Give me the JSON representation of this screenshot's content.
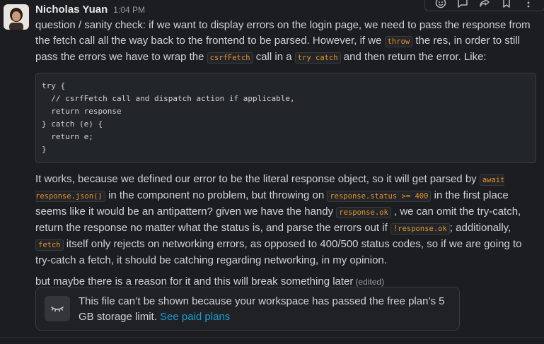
{
  "message": {
    "author": "Nicholas Yuan",
    "time": "1:04 PM",
    "para1": {
      "t1": "question / sanity check: if we want to display errors on the login page, we need to pass the response from the fetch call all the way back to the frontend to be parsed. However, if we ",
      "c1": "throw",
      "t2": " the res, in order to still pass the errors we have to wrap the ",
      "c2": "csrfFetch",
      "t3": " call in a ",
      "c3": "try catch",
      "t4": " and then return the error. Like:"
    },
    "code_block": "try {\n  // csrfFetch call and dispatch action if applicable,\n  return response\n} catch (e) {\n  return e;\n}",
    "para2": {
      "t1": "It works, because we defined our error to be the literal response object, so it will get parsed by ",
      "c1": "await response.json()",
      "t2": " in the component no problem, but throwing on ",
      "c2": "response.status >= 400",
      "t3": " in the first place seems like it would be an antipattern? given we have the handy ",
      "c3": "response.ok",
      "t4": " , we can omit the try-catch, return the response no matter what the status is, and parse the errors out if ",
      "c4": "!response.ok",
      "t5": "; additionally, ",
      "c5": "fetch",
      "t6": " itself only rejects on networking errors, as opposed to 400/500 status codes, so if we are going to try-catch a fetch, it should be catching regarding networking, in my opinion."
    },
    "para3": "but maybe there is a reason for it and this will break something later",
    "edited_label": "(edited)"
  },
  "attachment": {
    "text": "This file can’t be shown because your workspace has passed the free plan’s 5 GB storage limit.",
    "link": "See paid plans",
    "icon": "hidden-file-icon"
  },
  "toolbar": {
    "icons": [
      "emoji-reaction-icon",
      "reply-thread-icon",
      "share-icon",
      "bookmark-icon",
      "more-actions-icon"
    ]
  },
  "colors": {
    "background": "#1b1d21",
    "inline_code": "#e8912d",
    "link": "#1d9bd1"
  }
}
